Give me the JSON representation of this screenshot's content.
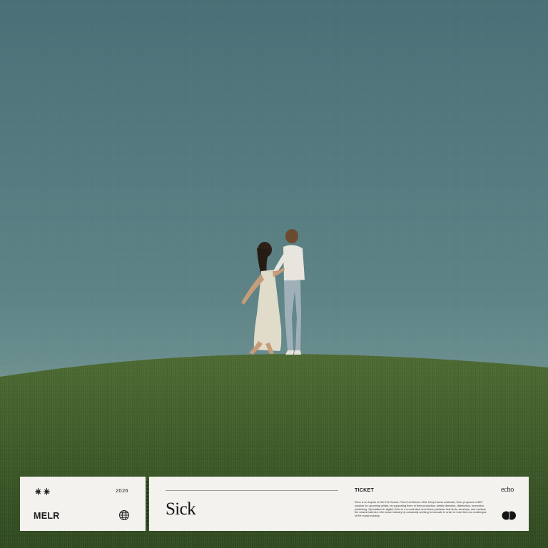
{
  "ticket": {
    "year": "2026",
    "artist": "MELR",
    "title": "Sick",
    "label": "TICKET",
    "brand": "echo",
    "description": "Echo is an imprint of Get The Sound. Part of an Electro Chill, Deep House aesthetic, Echo proposes a 360° solution for upcoming artists, by supporting them in their production, artistic direction, distribution, promotion, publishing. Specialised in digital, Echo is a record label and Music publisher that finds, develops, and markets the newest talents in the music industry by constantly seeking to innovate in order to meet the new challenges of the music industry."
  },
  "icons": {
    "cluster": "snowflake-pair-icon",
    "globe": "globe-icon",
    "logo": "echo-logo-icon"
  },
  "colors": {
    "sky_top": "#4b6f76",
    "sky_bottom": "#73958f",
    "grass": "#3e5a2c",
    "ticket": "#f3f2ee",
    "ink": "#1e1e1e"
  }
}
